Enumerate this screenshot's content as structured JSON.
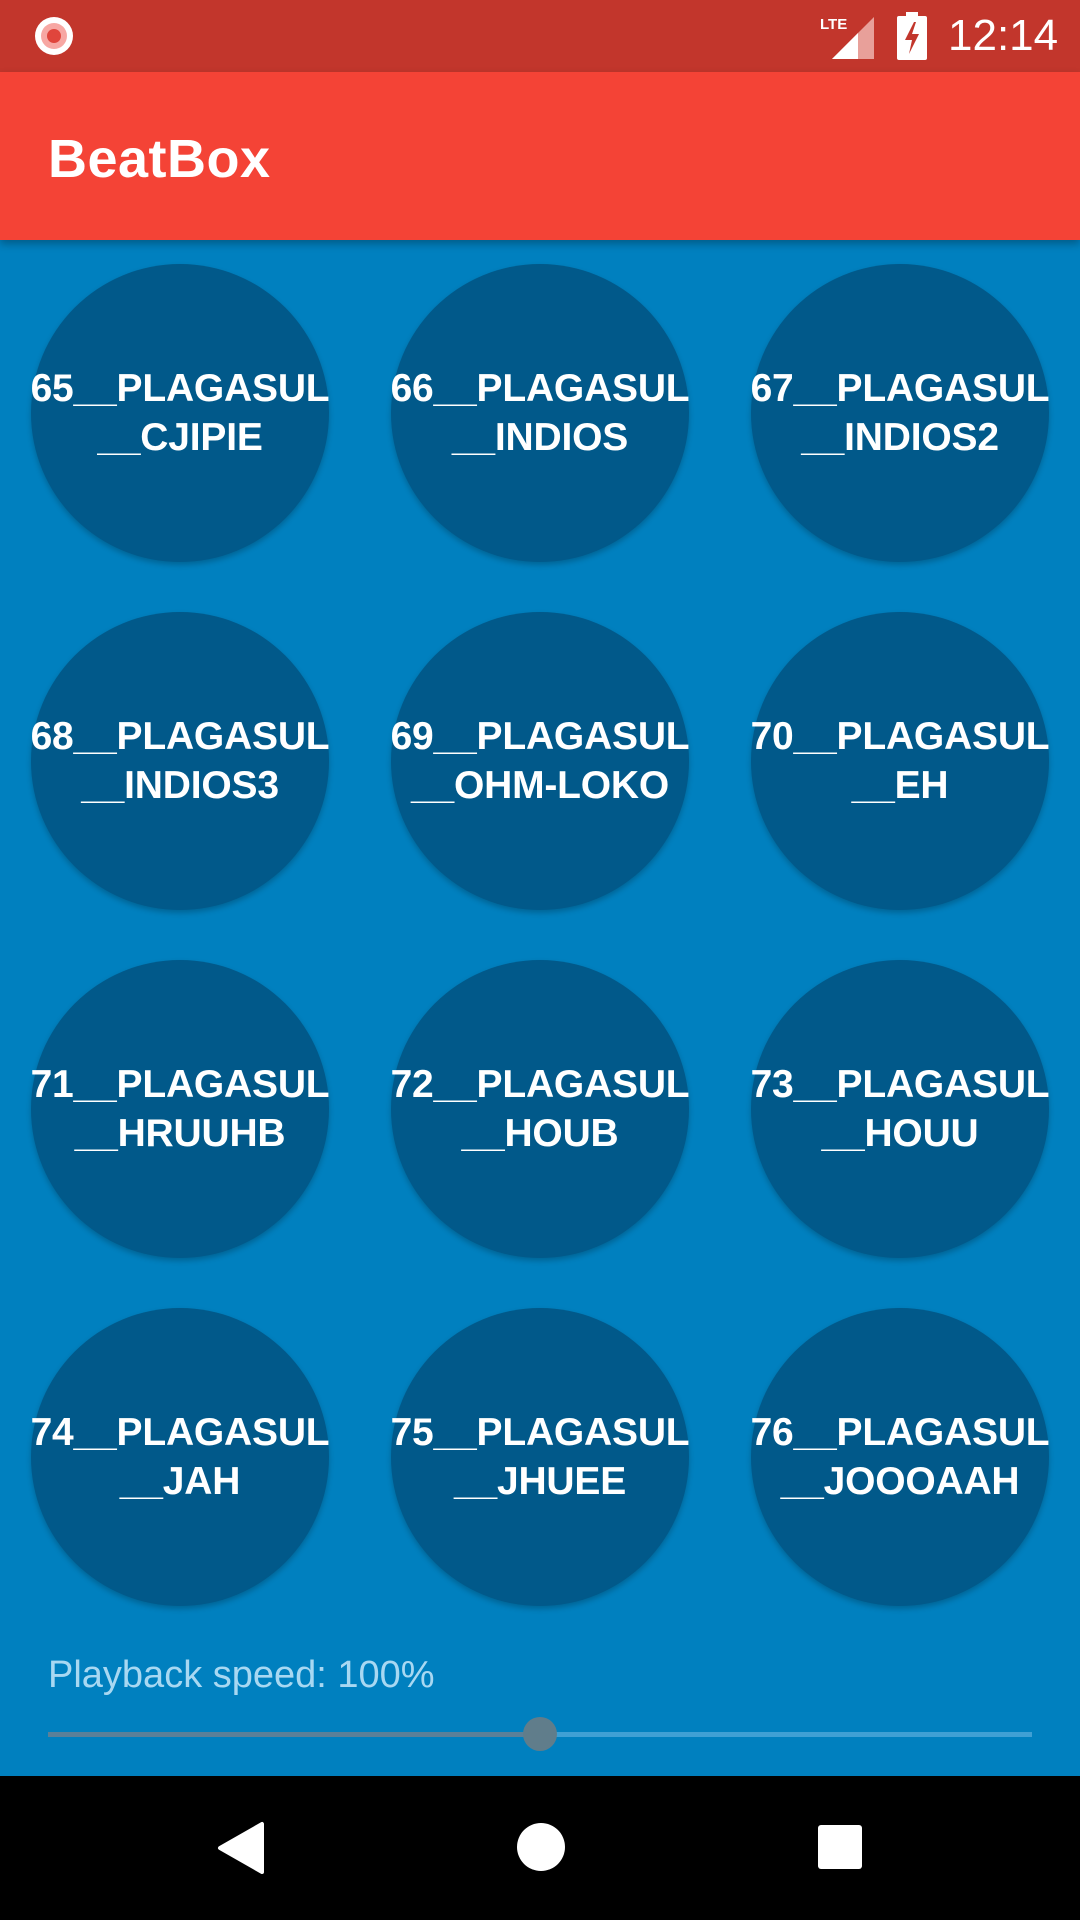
{
  "status_bar": {
    "time": "12:14",
    "network_label": "LTE",
    "icons": [
      "screen-record-icon",
      "lte-signal-icon",
      "battery-charging-icon"
    ]
  },
  "app_bar": {
    "title": "BeatBox"
  },
  "sounds": [
    "65__PLAGASUL\n__CJIPIE",
    "66__PLAGASUL\n__INDIOS",
    "67__PLAGASUL\n__INDIOS2",
    "68__PLAGASUL\n__INDIOS3",
    "69__PLAGASUL\n__OHM-LOKO",
    "70__PLAGASUL\n__EH",
    "71__PLAGASUL\n__HRUUHB",
    "72__PLAGASUL\n__HOUB",
    "73__PLAGASUL\n__HOUU",
    "74__PLAGASUL\n__JAH",
    "75__PLAGASUL\n__JHUEE",
    "76__PLAGASUL\n__JOOOAAH"
  ],
  "playback": {
    "label": "Playback speed: 100%",
    "progress_fraction": 0.5
  },
  "nav_bar": {
    "icons": [
      "back-icon",
      "home-icon",
      "recents-icon"
    ]
  },
  "colors": {
    "status_bar": "#C2362C",
    "app_bar": "#F44336",
    "background": "#0080BF",
    "button": "#01598A",
    "speed_label": "#A8D8F2",
    "seek_thumb": "#607D8B"
  }
}
